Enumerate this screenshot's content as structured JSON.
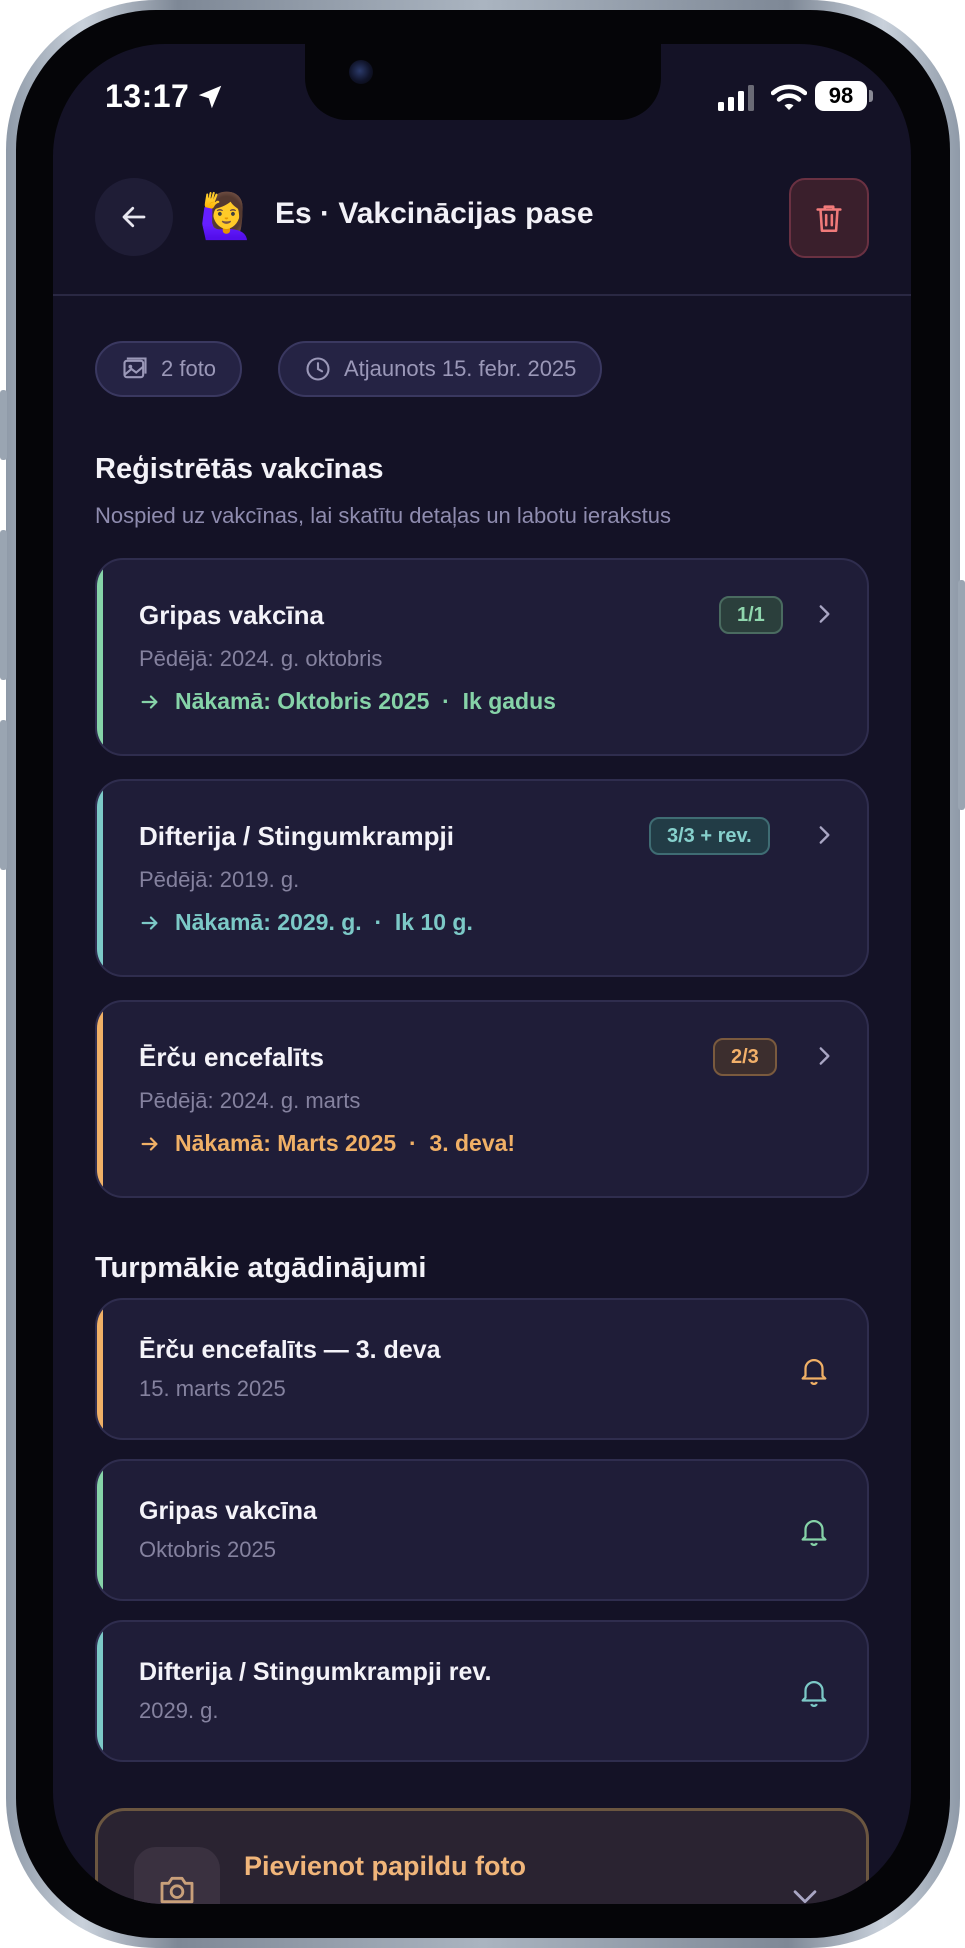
{
  "status_bar": {
    "time": "13:17",
    "battery": "98"
  },
  "header": {
    "emoji": "🙋‍♀️",
    "title": "Es · Vakcinācijas pase"
  },
  "chips": [
    {
      "label": "2 foto",
      "icon": "image-icon"
    },
    {
      "label": "Atjaunots 15. febr. 2025",
      "icon": "clock-icon"
    }
  ],
  "vaccines_section": {
    "title": "Reģistrētās vakcīnas",
    "subtitle": "Nospied uz vakcīnas, lai skatītu detaļas un labotu ierakstus"
  },
  "vaccines": [
    {
      "name": "Gripas vakcīna",
      "badge": "1/1",
      "last": "Pēdējā: 2024. g. oktobris",
      "next": "Nākamā: Oktobris 2025  ·  Ik gadus",
      "color": "#86d3a8"
    },
    {
      "name": "Difterija / Stingumkrampji",
      "badge": "3/3 + rev.",
      "last": "Pēdējā: 2019. g.",
      "next": "Nākamā: 2029. g.  ·  Ik 10 g.",
      "color": "#7cc9c7"
    },
    {
      "name": "Ērču encefalīts",
      "badge": "2/3",
      "last": "Pēdējā: 2024. g. marts",
      "next": "Nākamā: Marts 2025  ·  3. deva!",
      "color": "#f0b066"
    }
  ],
  "reminders_section": {
    "title": "Turpmākie atgādinājumi"
  },
  "reminders": [
    {
      "title": "Ērču encefalīts — 3. deva",
      "date": "15. marts 2025",
      "color": "#f0b066"
    },
    {
      "title": "Gripas vakcīna",
      "date": "Oktobris 2025",
      "color": "#86d3a8"
    },
    {
      "title": "Difterija / Stingumkrampji rev.",
      "date": "2029. g.",
      "color": "#7cc9c7"
    }
  ],
  "add_photo": {
    "label": "Pievienot papildu foto"
  }
}
